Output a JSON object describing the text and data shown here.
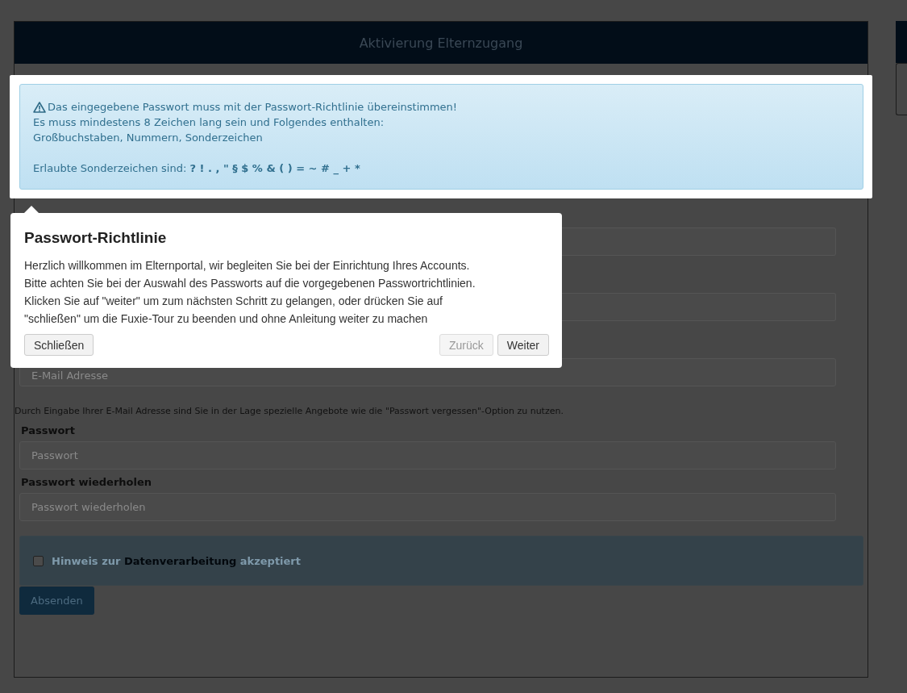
{
  "window": {
    "title": "Aktivierung Elternzugang"
  },
  "alert": {
    "lines": [
      "Das eingegebene Passwort muss mit der Passwort-Richtlinie übereinstimmen!",
      "Es muss mindestens 8 Zeichen lang sein und Folgendes enthalten:",
      "Großbuchstaben, Nummern, Sonderzeichen"
    ],
    "chars_label": "Erlaubte Sonderzeichen sind:",
    "chars": "? ! . , \" § $ % & ( ) = ~ # _ + *"
  },
  "popover": {
    "title": "Passwort-Richtlinie",
    "text": [
      "Herzlich willkommen im Elternportal, wir begleiten Sie bei der Einrichtung Ihres Accounts.",
      "Bitte achten Sie bei der Auswahl des Passworts auf die vorgegebenen Passwortrichtlinien.",
      "Klicken Sie auf \"weiter\" um zum nächsten Schritt zu gelangen, oder drücken Sie auf",
      "\"schließen\" um die Fuxie-Tour zu beenden und ohne Anleitung weiter zu machen"
    ],
    "buttons": [
      {
        "label": "Schließen",
        "disabled": false,
        "kind": "left"
      },
      {
        "label": "Zurück",
        "disabled": true,
        "kind": "right"
      },
      {
        "label": "Weiter",
        "disabled": false,
        "kind": "right"
      }
    ]
  },
  "form": {
    "email": {
      "placeholder": "E-Mail Adresse",
      "help": "Durch Eingabe Ihrer E-Mail Adresse sind Sie in der Lage spezielle Angebote wie die \"Passwort vergessen\"-Option zu nutzen."
    },
    "fields": [
      {
        "label": "Passwort",
        "placeholder": "Passwort"
      },
      {
        "label": "Passwort wiederholen",
        "placeholder": "Passwort wiederholen"
      }
    ],
    "consent": {
      "label": "Hinweis zur **Datenverarbeitung** akzeptiert",
      "checked": false
    },
    "submit": "Absenden"
  }
}
